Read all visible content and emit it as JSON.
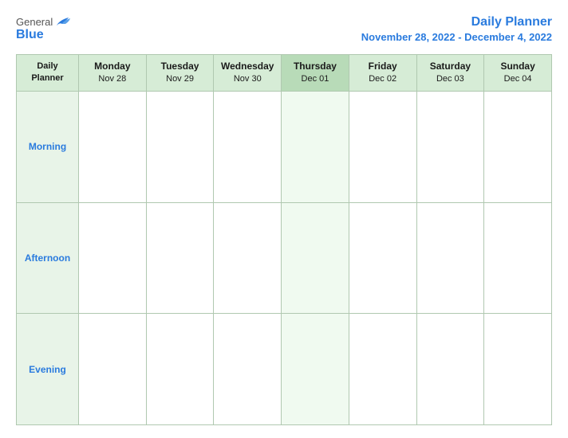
{
  "logo": {
    "general": "General",
    "blue": "Blue"
  },
  "header": {
    "title": "Daily Planner",
    "date_range": "November 28, 2022 - December 4, 2022"
  },
  "table": {
    "label_header_line1": "Daily",
    "label_header_line2": "Planner",
    "columns": [
      {
        "day": "Monday",
        "date": "Nov 28",
        "today": false
      },
      {
        "day": "Tuesday",
        "date": "Nov 29",
        "today": false
      },
      {
        "day": "Wednesday",
        "date": "Nov 30",
        "today": false
      },
      {
        "day": "Thursday",
        "date": "Dec 01",
        "today": true
      },
      {
        "day": "Friday",
        "date": "Dec 02",
        "today": false
      },
      {
        "day": "Saturday",
        "date": "Dec 03",
        "today": false
      },
      {
        "day": "Sunday",
        "date": "Dec 04",
        "today": false
      }
    ],
    "rows": [
      {
        "label": "Morning"
      },
      {
        "label": "Afternoon"
      },
      {
        "label": "Evening"
      }
    ]
  }
}
